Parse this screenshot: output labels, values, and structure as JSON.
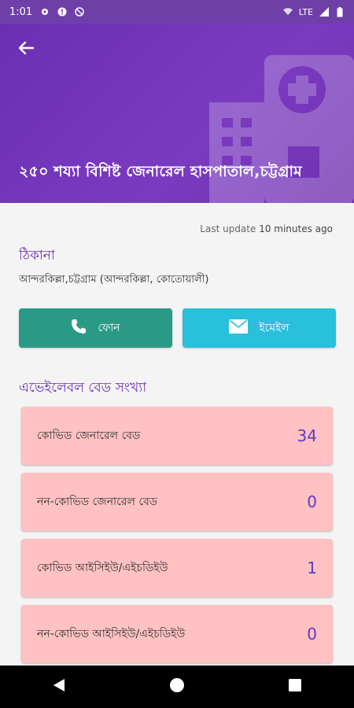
{
  "status_bar": {
    "time": "1:01",
    "network": "LTE",
    "icons": [
      "gear-icon",
      "alert-icon",
      "data-saver-icon",
      "wifi-icon",
      "signal-icon",
      "battery-icon"
    ]
  },
  "header": {
    "title": "২৫০ শয্যা বিশিষ্ট জেনারেল হাসপাতাল,চট্টগ্রাম",
    "background_color": "#6a2fb2"
  },
  "update": {
    "prefix": "Last update",
    "value": "10 minutes ago"
  },
  "address": {
    "heading": "ঠিকানা",
    "text": "আন্দরকিল্লা,চট্টগ্রাম (আন্দরকিল্লা, কোতোয়ালী)"
  },
  "actions": {
    "phone_label": "ফোন",
    "email_label": "ইমেইল",
    "phone_color": "#2a9a86",
    "email_color": "#28c0db"
  },
  "beds": {
    "heading": "এভেইলেবল বেড সংখ্যা",
    "card_color": "#ffc1c1",
    "items": [
      {
        "label": "কোভিড জেনারেল বেড",
        "count": "34"
      },
      {
        "label": "নন-কোভিড জেনারেল বেড",
        "count": "0"
      },
      {
        "label": "কোভিড আইসিইউ/এইচডিইউ",
        "count": "1"
      },
      {
        "label": "নন-কোভিড আইসিইউ/এইচডিইউ",
        "count": "0"
      }
    ]
  },
  "nav": {
    "icons": [
      "back-triangle-icon",
      "home-circle-icon",
      "recents-square-icon"
    ]
  }
}
